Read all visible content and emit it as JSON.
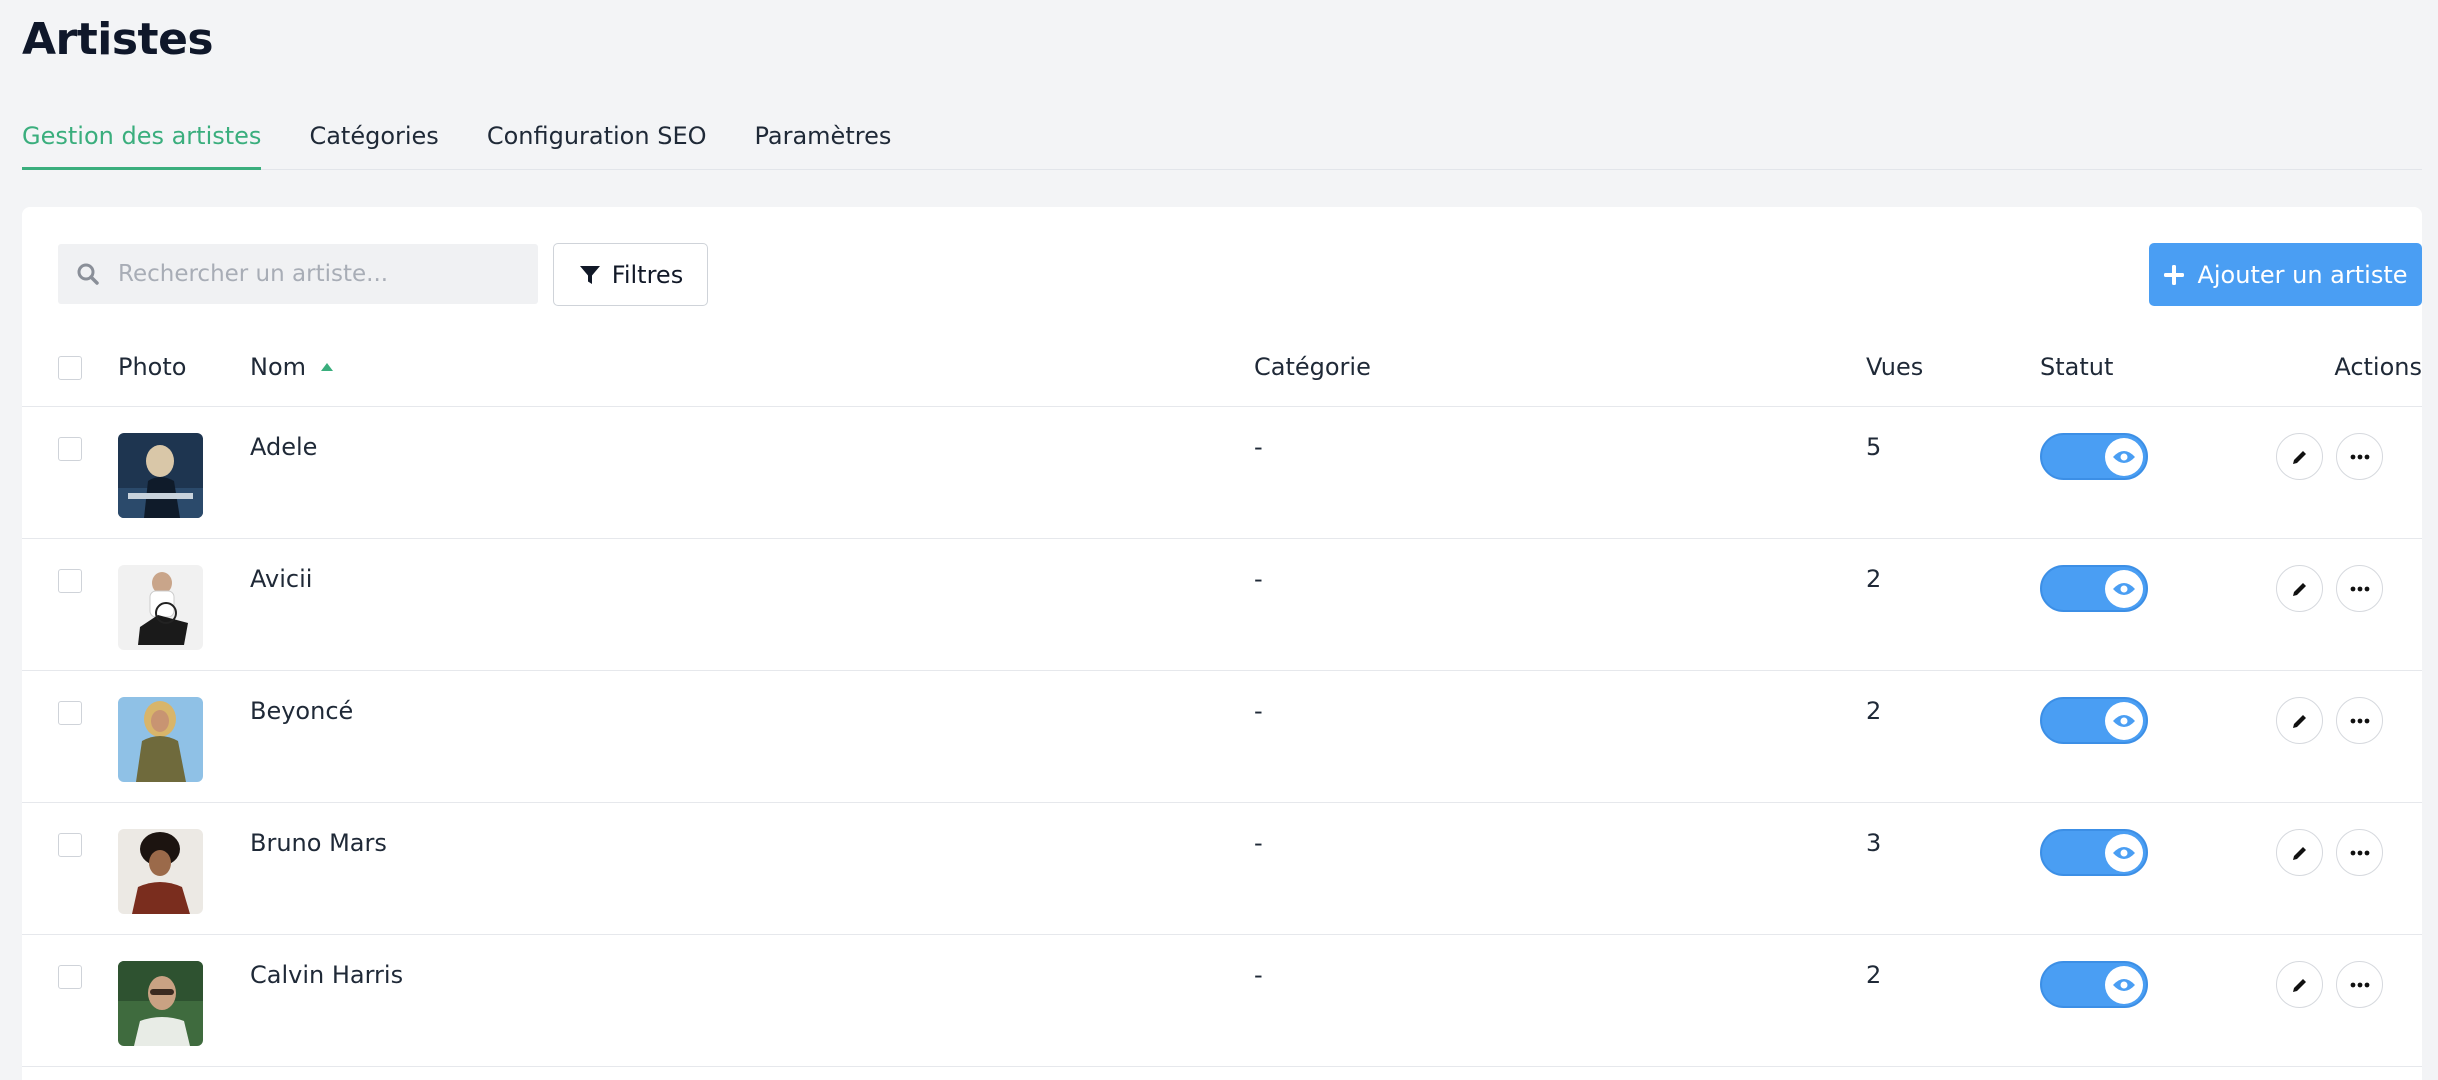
{
  "page": {
    "title": "Artistes"
  },
  "tabs": [
    {
      "label": "Gestion des artistes",
      "active": true
    },
    {
      "label": "Catégories",
      "active": false
    },
    {
      "label": "Configuration SEO",
      "active": false
    },
    {
      "label": "Paramètres",
      "active": false
    }
  ],
  "toolbar": {
    "search_placeholder": "Rechercher un artiste...",
    "filter_label": "Filtres",
    "add_label": "Ajouter un artiste"
  },
  "table": {
    "headers": {
      "photo": "Photo",
      "name": "Nom",
      "category": "Catégorie",
      "views": "Vues",
      "status": "Statut",
      "actions": "Actions"
    },
    "sort": {
      "column": "name",
      "direction": "asc"
    },
    "rows": [
      {
        "name": "Adele",
        "category": "-",
        "views": "5",
        "status": "visible"
      },
      {
        "name": "Avicii",
        "category": "-",
        "views": "2",
        "status": "visible"
      },
      {
        "name": "Beyoncé",
        "category": "-",
        "views": "2",
        "status": "visible"
      },
      {
        "name": "Bruno Mars",
        "category": "-",
        "views": "3",
        "status": "visible"
      },
      {
        "name": "Calvin Harris",
        "category": "-",
        "views": "2",
        "status": "visible"
      }
    ]
  },
  "colors": {
    "accent_green": "#3aae7d",
    "primary_blue": "#4a9ef3",
    "background": "#f3f4f6"
  },
  "icons": {
    "search": "search-icon",
    "filter": "filter-icon",
    "add": "plus-icon",
    "sort": "sort-asc-icon",
    "visibility": "eye-icon",
    "edit": "pencil-icon",
    "more": "more-horizontal-icon"
  }
}
